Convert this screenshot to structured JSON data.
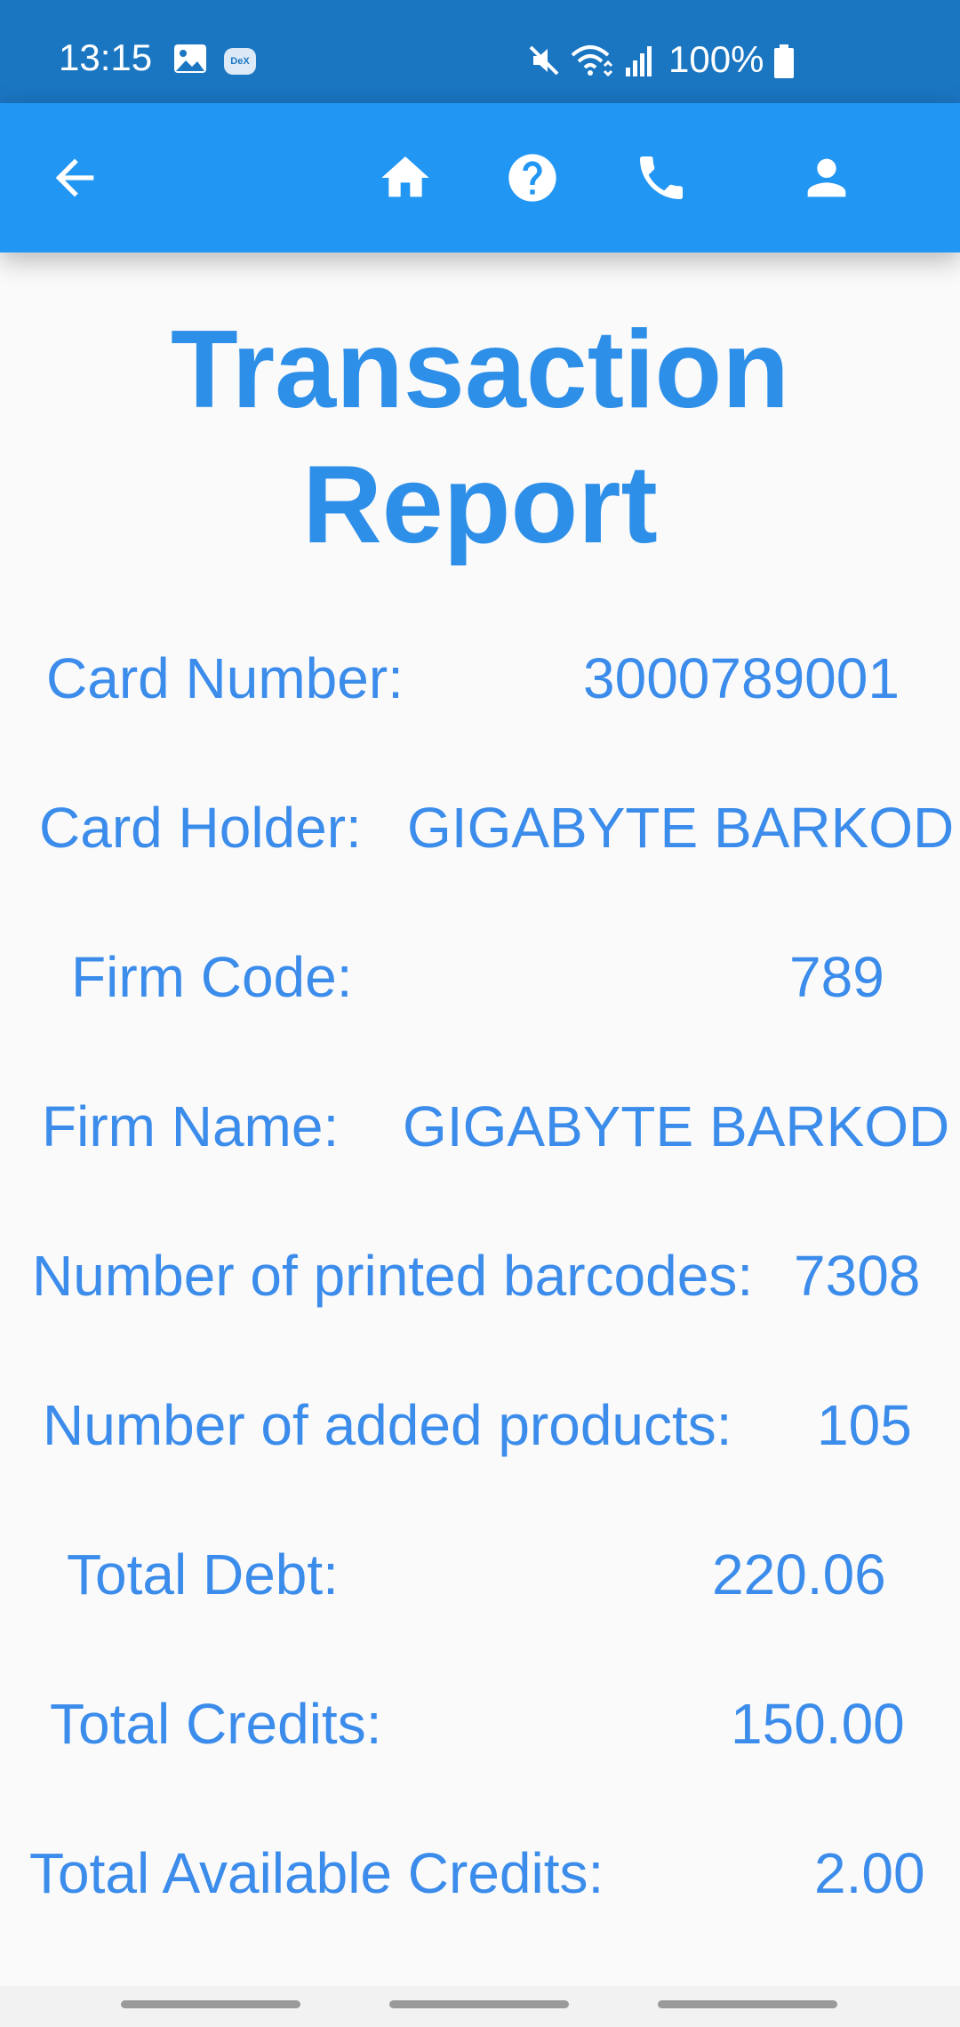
{
  "status_bar": {
    "time": "13:15",
    "dex_label": "DeX",
    "battery": "100%",
    "icons": [
      "gallery-icon",
      "dex-icon",
      "mute-icon",
      "wifi-icon",
      "signal-icon",
      "battery-icon"
    ]
  },
  "app_bar": {
    "background": "#2196f3",
    "icons": [
      "back-arrow-icon",
      "home-icon",
      "help-icon",
      "phone-icon",
      "account-icon"
    ]
  },
  "page": {
    "title": "Transaction Report",
    "rows": [
      {
        "label": "Card Number:",
        "value": "3000789001"
      },
      {
        "label": "Card Holder:",
        "value": "GIGABYTE BARKOD"
      },
      {
        "label": "Firm Code:",
        "value": "789"
      },
      {
        "label": "Firm Name:",
        "value": "GIGABYTE BARKOD"
      },
      {
        "label": "Number of printed barcodes:",
        "value": "7308"
      },
      {
        "label": "Number of added products:",
        "value": "105"
      },
      {
        "label": "Total Debt:",
        "value": "220.06"
      },
      {
        "label": "Total Credits:",
        "value": "150.00"
      },
      {
        "label": "Total Available Credits:",
        "value": "2.00"
      }
    ]
  },
  "colors": {
    "status_bar": "#1b76c2",
    "app_bar": "#2196f3",
    "title": "#2e8fe8",
    "text": "#3b8ceb",
    "background": "#fafafa"
  }
}
